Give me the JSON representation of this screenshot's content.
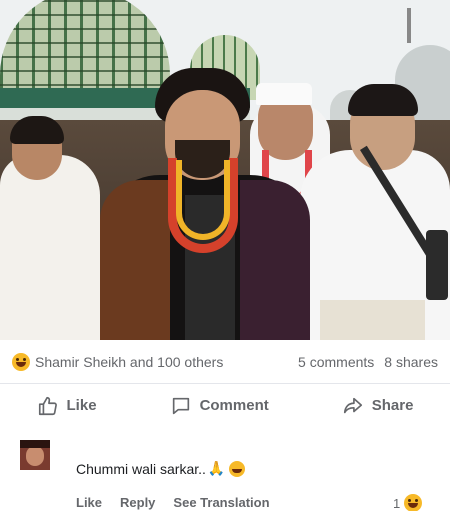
{
  "post": {
    "photo_alt_icon": "photo-scene",
    "reactions_summary": "Shamir Sheikh and 100 others",
    "comments_count": "5 comments",
    "shares_count": "8 shares"
  },
  "actions": {
    "like": "Like",
    "comment": "Comment",
    "share": "Share"
  },
  "comment": {
    "text": "Chummi wali sarkar..",
    "meta": {
      "like": "Like",
      "reply": "Reply",
      "translate": "See Translation"
    },
    "reaction_count": "1"
  },
  "colors": {
    "reaction": "#f7b928",
    "muted": "#65676b",
    "text": "#1c1e21"
  }
}
